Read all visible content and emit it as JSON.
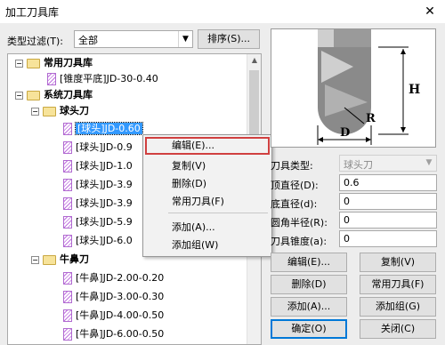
{
  "window": {
    "title": "加工刀具库",
    "close_glyph": "✕"
  },
  "filter": {
    "label": "类型过滤(T):",
    "value": "全部",
    "sort_label": "排序(S)..."
  },
  "tree": {
    "common_root": "常用刀具库",
    "common_item": "[锥度平底]JD-30-0.40",
    "system_root": "系统刀具库",
    "ball_group": "球头刀",
    "ball_items": [
      "[球头]JD-0.60",
      "[球头]JD-0.9",
      "[球头]JD-1.0",
      "[球头]JD-3.9",
      "[球头]JD-3.9",
      "[球头]JD-5.9",
      "[球头]JD-6.0"
    ],
    "bull_group": "牛鼻刀",
    "bull_items": [
      "[牛鼻]JD-2.00-0.20",
      "[牛鼻]JD-3.00-0.30",
      "[牛鼻]JD-4.00-0.50",
      "[牛鼻]JD-6.00-0.50",
      "[牛鼻]JD-8.00-0.50"
    ]
  },
  "context_menu": {
    "edit": "编辑(E)...",
    "copy": "复制(V)",
    "delete": "删除(D)",
    "common": "常用刀具(F)",
    "add": "添加(A)...",
    "add_group": "添加组(W)"
  },
  "preview": {
    "label_h": "H",
    "label_r": "R",
    "label_d": "D"
  },
  "properties": {
    "tool_type_label": "刀具类型:",
    "tool_type_value": "球头刀",
    "top_dia_label": "顶直径(D):",
    "top_dia_value": "0.6",
    "bottom_dia_label": "底直径(d):",
    "bottom_dia_value": "0",
    "corner_radius_label": "圆角半径(R):",
    "corner_radius_value": "0",
    "taper_label": "刀具锥度(a):",
    "taper_value": "0"
  },
  "buttons": {
    "edit": "编辑(E)...",
    "copy": "复制(V)",
    "delete": "删除(D)",
    "common": "常用刀具(F)",
    "add": "添加(A)...",
    "add_group": "添加组(G)",
    "ok": "确定(O)",
    "close": "关闭(C)"
  },
  "colors": {
    "selection": "#3399ff",
    "highlight_box": "#d04040",
    "default_button_border": "#0078d7"
  }
}
